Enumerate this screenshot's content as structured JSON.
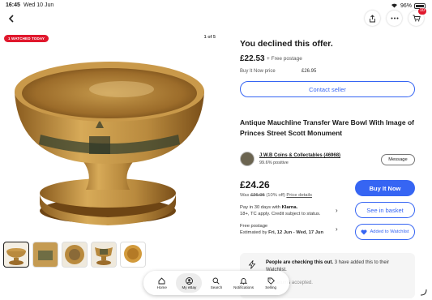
{
  "status_bar": {
    "time": "16:45",
    "date": "Wed 10 Jun",
    "battery": "96%"
  },
  "cart": {
    "count": "10"
  },
  "gallery": {
    "tag": "1 WATCHED TODAY",
    "counter": "1 of 5",
    "thumbnail_count": 5
  },
  "offer": {
    "heading": "You declined this offer.",
    "price": "£22.53",
    "postage": "+ Free postage",
    "bin_label": "Buy It Now price",
    "bin_price": "£26.95",
    "contact_label": "Contact seller"
  },
  "listing": {
    "title": "Antique Mauchline Transfer Ware Bowl With Image of Princes Street Scott Monument"
  },
  "seller": {
    "name": "J.W.B Coins & Collectables",
    "count": "(46968)",
    "feedback": "99.6% positive",
    "message_label": "Message"
  },
  "pricing": {
    "price": "£24.26",
    "was_prefix": "Was",
    "was_price": "£26.95",
    "discount": "(10% off)",
    "details_link": "Price details",
    "klarna_prefix": "Pay in 30 days with",
    "klarna_brand": "Klarna.",
    "klarna_sub": "18+, TC apply. Credit subject to status.",
    "postage_title": "Free postage",
    "postage_est_prefix": "Estimated by",
    "postage_dates": "Fri, 12 Jun - Wed, 17 Jun"
  },
  "actions": {
    "buy_now": "Buy It Now",
    "see_basket": "See in basket",
    "watchlist": "Added to Watchlist"
  },
  "notice": {
    "bold": "People are checking this out.",
    "text": " 3 have added this to their Watchlist.",
    "sub": "ay. Returns accepted."
  },
  "tabs": [
    {
      "label": "Home"
    },
    {
      "label": "My eBay"
    },
    {
      "label": "Search"
    },
    {
      "label": "Notifications"
    },
    {
      "label": "Selling"
    }
  ],
  "colors": {
    "accent": "#3665f3",
    "badge": "#e0182d",
    "wood": "#b98a3e"
  }
}
